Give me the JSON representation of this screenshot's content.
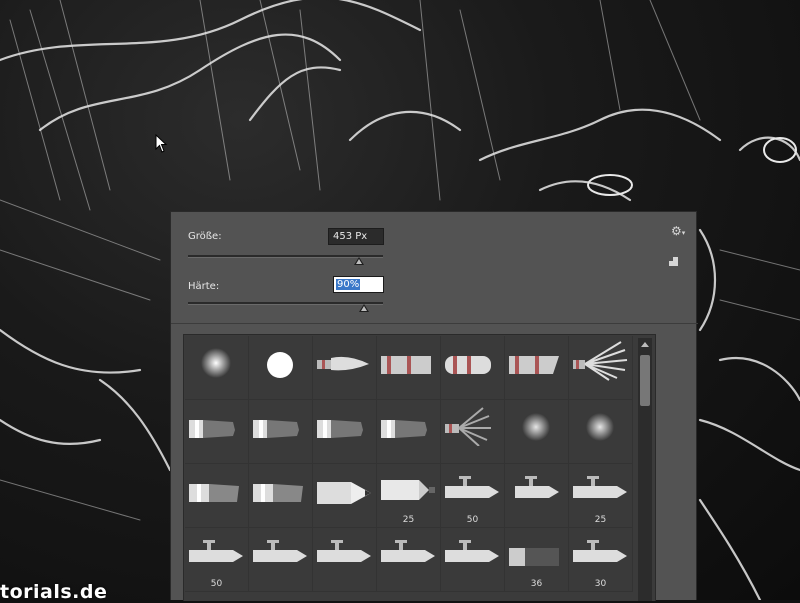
{
  "panel": {
    "size_label": "Größe:",
    "size_value": "453 Px",
    "size_slider": 0.87,
    "hardness_label": "Härte:",
    "hardness_value": "90%",
    "hardness_slider": 0.9,
    "gear_icon": "gear-icon",
    "new_preset_icon": "new-preset-icon"
  },
  "brushes": [
    {
      "type": "soft-round",
      "label": ""
    },
    {
      "type": "hard-round",
      "label": ""
    },
    {
      "type": "pointed-brush",
      "label": ""
    },
    {
      "type": "flat-brush",
      "label": ""
    },
    {
      "type": "round-flat-brush",
      "label": ""
    },
    {
      "type": "angled-brush",
      "label": ""
    },
    {
      "type": "fan-brush",
      "label": ""
    },
    {
      "type": "bristle-brush",
      "label": ""
    },
    {
      "type": "bristle-brush",
      "label": ""
    },
    {
      "type": "bristle-brush",
      "label": ""
    },
    {
      "type": "bristle-brush",
      "label": ""
    },
    {
      "type": "fan-brush-small",
      "label": ""
    },
    {
      "type": "soft-round-large",
      "label": ""
    },
    {
      "type": "soft-round-large",
      "label": ""
    },
    {
      "type": "bristle-wide",
      "label": ""
    },
    {
      "type": "bristle-wide",
      "label": ""
    },
    {
      "type": "pencil",
      "label": ""
    },
    {
      "type": "pencil-long",
      "label": "25"
    },
    {
      "type": "airbrush",
      "label": "50"
    },
    {
      "type": "airbrush-short",
      "label": ""
    },
    {
      "type": "airbrush",
      "label": "25"
    },
    {
      "type": "airbrush",
      "label": "50"
    },
    {
      "type": "airbrush",
      "label": ""
    },
    {
      "type": "airbrush",
      "label": ""
    },
    {
      "type": "airbrush",
      "label": ""
    },
    {
      "type": "airbrush",
      "label": ""
    },
    {
      "type": "bristle-dark",
      "label": "36"
    },
    {
      "type": "airbrush",
      "label": "30"
    }
  ],
  "watermark": "torials.de"
}
